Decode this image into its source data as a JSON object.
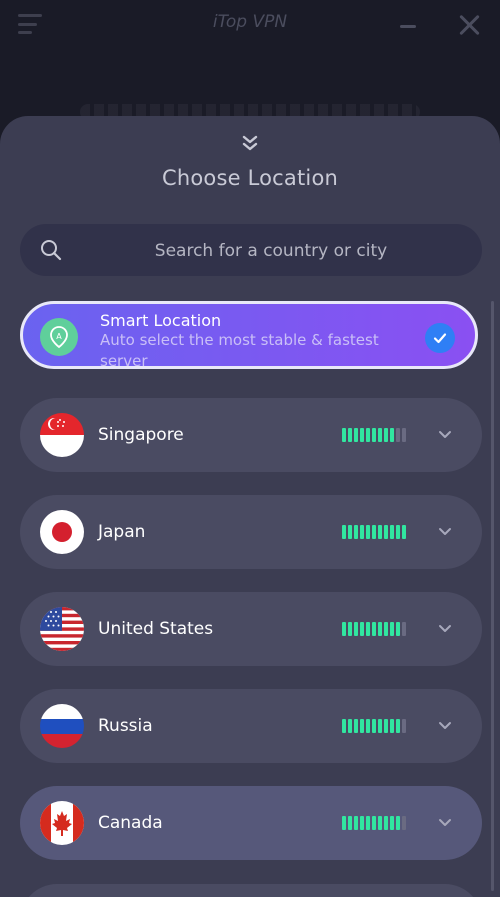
{
  "app": {
    "title": "iTop VPN"
  },
  "sheet": {
    "title": "Choose Location",
    "search_placeholder": "Search for a country or city"
  },
  "smart_location": {
    "title": "Smart Location",
    "description": "Auto select the most stable & fastest server",
    "selected": true
  },
  "countries": [
    {
      "name": "Singapore",
      "signal_bars": 9,
      "total_bars": 11
    },
    {
      "name": "Japan",
      "signal_bars": 11,
      "total_bars": 11
    },
    {
      "name": "United States",
      "signal_bars": 10,
      "total_bars": 11
    },
    {
      "name": "Russia",
      "signal_bars": 10,
      "total_bars": 11
    },
    {
      "name": "Canada",
      "signal_bars": 10,
      "total_bars": 11
    }
  ],
  "icons": {
    "menu": "menu-icon",
    "minimize": "minimize-icon",
    "close": "close-icon",
    "collapse": "double-chevron-down-icon",
    "search": "search-icon",
    "location": "location-pin-icon",
    "check": "check-icon",
    "expand": "chevron-down-icon"
  },
  "colors": {
    "accent_gradient_start": "#6a63f0",
    "accent_gradient_end": "#8a50f2",
    "signal_on": "#31e6a0",
    "signal_off": "#6a6b82",
    "check_bg": "#2f7ff5"
  }
}
